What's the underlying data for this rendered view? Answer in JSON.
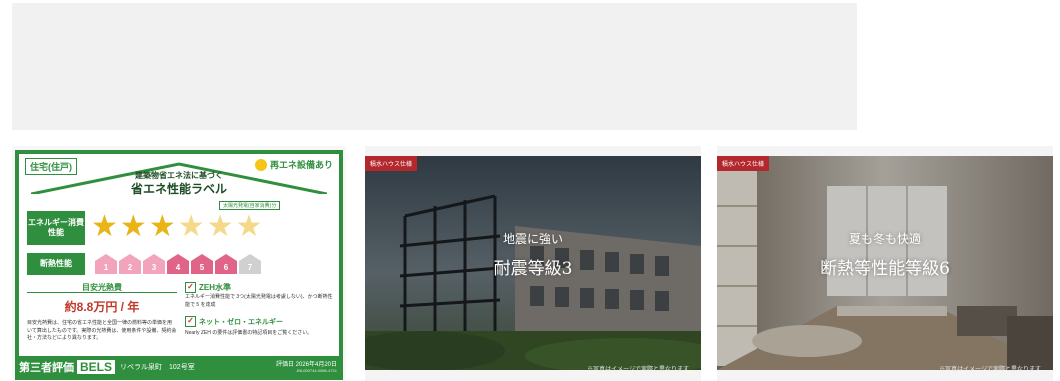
{
  "bels": {
    "house_type": "住宅(住戸)",
    "renewable": "再エネ設備あり",
    "law_text": "建築物省エネ法に基づく",
    "label_title": "省エネ性能ラベル",
    "solar_note": "太陽光発電(自家消費)分",
    "energy_label": "エネルギー消費性能",
    "energy_stars_total": 6,
    "energy_stars_filled": 3,
    "insulation_label": "断熱性能",
    "insulation_levels": [
      "1",
      "2",
      "3",
      "4",
      "5",
      "6",
      "7"
    ],
    "insulation_value": 6,
    "cost_label": "目安光熱費",
    "cost_value": "約8.8万円 / 年",
    "cost_note": "目安光熱費は、住宅の省エネ性能と全国一律の燃料等の単価を用いて算出したものです。実際の光熱費は、使用条件や設備、契約会社・方法などにより異なります。",
    "zeh_title": "ZEH水準",
    "zeh_text": "エネルギー消費性能で 3つ(太陽光発電は考慮しない)、かつ断熱性能で 5 を達成",
    "zeh_net": "ネット・ゼロ・エネルギー",
    "zeh_note": "Nearly ZEH の要件は評価書の特記項目をご覧ください。",
    "third_party": "第三者評価",
    "bels_logo": "BELS",
    "property": "リベラル泉町　102号室",
    "eval_date": "評価日 2026年4月20日",
    "eval_id": "JBL000744-0566-4721"
  },
  "cards": [
    {
      "badge": "積水ハウス仕様",
      "title_small": "地震に強い",
      "title_big": "耐震等級3",
      "disclaimer": "※写真はイメージで実際と異なります"
    },
    {
      "badge": "積水ハウス仕様",
      "title_small": "夏も冬も快適",
      "title_big": "断熱等性能等級6",
      "disclaimer": "※写真はイメージで実際と異なります"
    }
  ],
  "colors": {
    "bels_green": "#2f8f3e",
    "badge_red": "#b3282d",
    "cost_red": "#c0392b"
  }
}
